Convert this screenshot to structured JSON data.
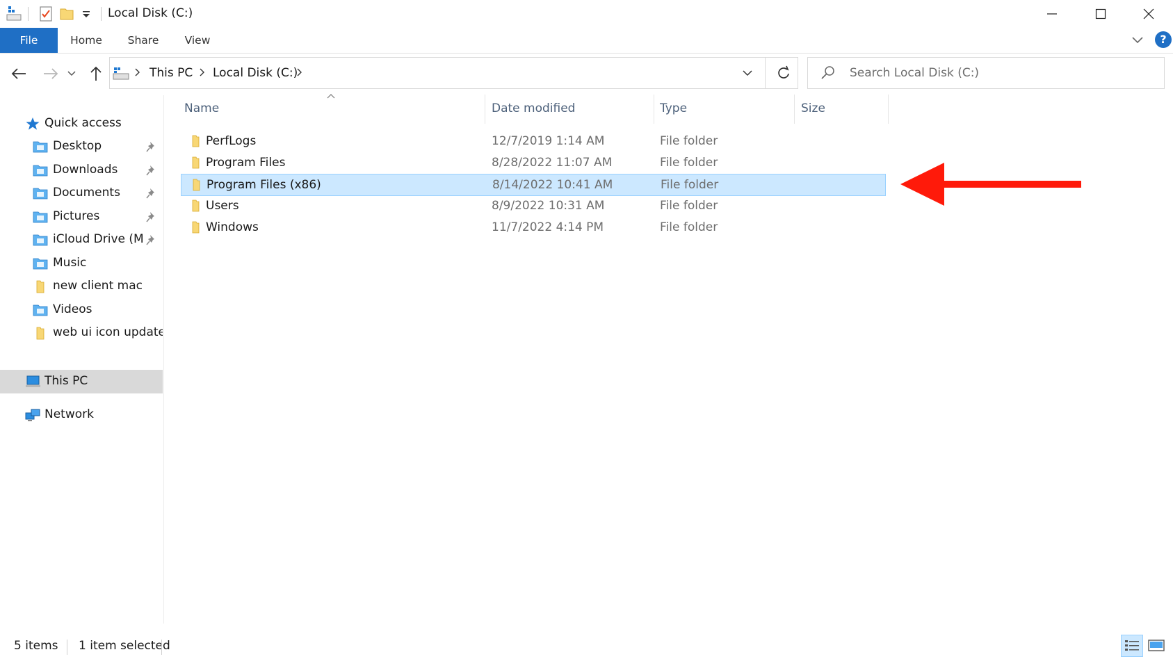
{
  "window": {
    "title": "Local Disk (C:)",
    "minimize_label": "Minimize",
    "maximize_label": "Maximize",
    "close_label": "Close"
  },
  "ribbon": {
    "tabs": [
      {
        "label": "File",
        "active": true
      },
      {
        "label": "Home"
      },
      {
        "label": "Share"
      },
      {
        "label": "View"
      }
    ],
    "help_glyph": "?"
  },
  "address": {
    "breadcrumbs": [
      "This PC",
      "Local Disk (C:)"
    ]
  },
  "search": {
    "placeholder": "Search Local Disk (C:)"
  },
  "nav": {
    "quick_access": "Quick access",
    "quick_items": [
      {
        "label": "Desktop",
        "icon": "desktop-folder-icon",
        "pinned": true
      },
      {
        "label": "Downloads",
        "icon": "downloads-folder-icon",
        "pinned": true
      },
      {
        "label": "Documents",
        "icon": "documents-folder-icon",
        "pinned": true
      },
      {
        "label": "Pictures",
        "icon": "pictures-folder-icon",
        "pinned": true
      },
      {
        "label": "iCloud Drive (Ma",
        "icon": "icloud-folder-icon",
        "pinned": true
      },
      {
        "label": "Music",
        "icon": "music-folder-icon",
        "pinned": false
      },
      {
        "label": "new client mac",
        "icon": "folder-icon",
        "pinned": false
      },
      {
        "label": "Videos",
        "icon": "videos-folder-icon",
        "pinned": false
      },
      {
        "label": "web ui icon update",
        "icon": "folder-icon",
        "pinned": false
      }
    ],
    "this_pc": "This PC",
    "network": "Network"
  },
  "columns": {
    "name": "Name",
    "date": "Date modified",
    "type": "Type",
    "size": "Size"
  },
  "files": [
    {
      "name": "PerfLogs",
      "date": "12/7/2019 1:14 AM",
      "type": "File folder",
      "selected": false
    },
    {
      "name": "Program Files",
      "date": "8/28/2022 11:07 AM",
      "type": "File folder",
      "selected": false
    },
    {
      "name": "Program Files (x86)",
      "date": "8/14/2022 10:41 AM",
      "type": "File folder",
      "selected": true
    },
    {
      "name": "Users",
      "date": "8/9/2022 10:31 AM",
      "type": "File folder",
      "selected": false
    },
    {
      "name": "Windows",
      "date": "11/7/2022 4:14 PM",
      "type": "File folder",
      "selected": false
    }
  ],
  "status": {
    "items": "5 items",
    "selected": "1 item selected"
  },
  "colors": {
    "accent": "#1f6fc5",
    "selection": "#cce8ff",
    "arrow": "#ff1a0a",
    "folder": "#f8d775"
  }
}
